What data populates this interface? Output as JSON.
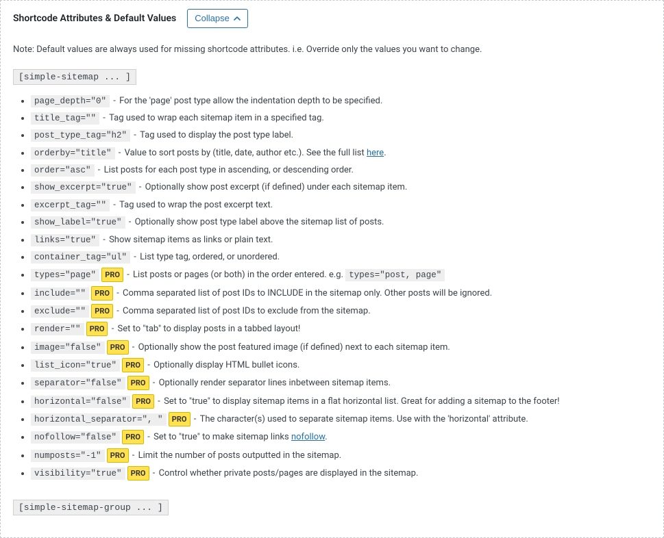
{
  "header": {
    "title": "Shortcode Attributes & Default Values",
    "collapse_label": "Collapse"
  },
  "note": "Note: Default values are always used for missing shortcode attributes. i.e. Override only the values you want to change.",
  "shortcode1": "[simple-sitemap ... ]",
  "shortcode2": "[simple-sitemap-group ... ]",
  "pro_badge": "PRO",
  "attrs": [
    {
      "code": "page_depth=\"0\"",
      "pro": false,
      "desc": "For the 'page' post type allow the indentation depth to be specified."
    },
    {
      "code": "title_tag=\"\"",
      "pro": false,
      "desc": "Tag used to wrap each sitemap item in a specified tag."
    },
    {
      "code": "post_type_tag=\"h2\"",
      "pro": false,
      "desc": "Tag used to display the post type label."
    },
    {
      "code": "orderby=\"title\"",
      "pro": false,
      "desc_pre": "Value to sort posts by (title, date, author etc.). See the full list ",
      "link_text": "here",
      "desc_post": "."
    },
    {
      "code": "order=\"asc\"",
      "pro": false,
      "desc": "List posts for each post type in ascending, or descending order."
    },
    {
      "code": "show_excerpt=\"true\"",
      "pro": false,
      "desc": "Optionally show post excerpt (if defined) under each sitemap item."
    },
    {
      "code": "excerpt_tag=\"\"",
      "pro": false,
      "desc": "Tag used to wrap the post excerpt text."
    },
    {
      "code": "show_label=\"true\"",
      "pro": false,
      "desc": "Optionally show post type label above the sitemap list of posts."
    },
    {
      "code": "links=\"true\"",
      "pro": false,
      "desc": "Show sitemap items as links or plain text."
    },
    {
      "code": "container_tag=\"ul\"",
      "pro": false,
      "desc": "List type tag, ordered, or unordered."
    },
    {
      "code": "types=\"page\"",
      "pro": true,
      "desc": "List posts or pages (or both) in the order entered. e.g. ",
      "example_code": "types=\"post, page\""
    },
    {
      "code": "include=\"\"",
      "pro": true,
      "desc": "Comma separated list of post IDs to INCLUDE in the sitemap only. Other posts will be ignored."
    },
    {
      "code": "exclude=\"\"",
      "pro": true,
      "desc": "Comma separated list of post IDs to exclude from the sitemap."
    },
    {
      "code": "render=\"\"",
      "pro": true,
      "desc": "Set to \"tab\" to display posts in a tabbed layout!"
    },
    {
      "code": "image=\"false\"",
      "pro": true,
      "desc": "Optionally show the post featured image (if defined) next to each sitemap item."
    },
    {
      "code": "list_icon=\"true\"",
      "pro": true,
      "desc": "Optionally display HTML bullet icons."
    },
    {
      "code": "separator=\"false\"",
      "pro": true,
      "desc": "Optionally render separator lines inbetween sitemap items."
    },
    {
      "code": "horizontal=\"false\"",
      "pro": true,
      "desc": "Set to \"true\" to display sitemap items in a flat horizontal list. Great for adding a sitemap to the footer!"
    },
    {
      "code": "horizontal_separator=\", \"",
      "pro": true,
      "desc": "The character(s) used to separate sitemap items. Use with the 'horizontal' attribute."
    },
    {
      "code": "nofollow=\"false\"",
      "pro": true,
      "desc_pre": "Set to \"true\" to make sitemap links ",
      "link_text": "nofollow",
      "desc_post": "."
    },
    {
      "code": "numposts=\"-1\"",
      "pro": true,
      "desc": "Limit the number of posts outputted in the sitemap."
    },
    {
      "code": "visibility=\"true\"",
      "pro": true,
      "desc": "Control whether private posts/pages are displayed in the sitemap."
    }
  ]
}
